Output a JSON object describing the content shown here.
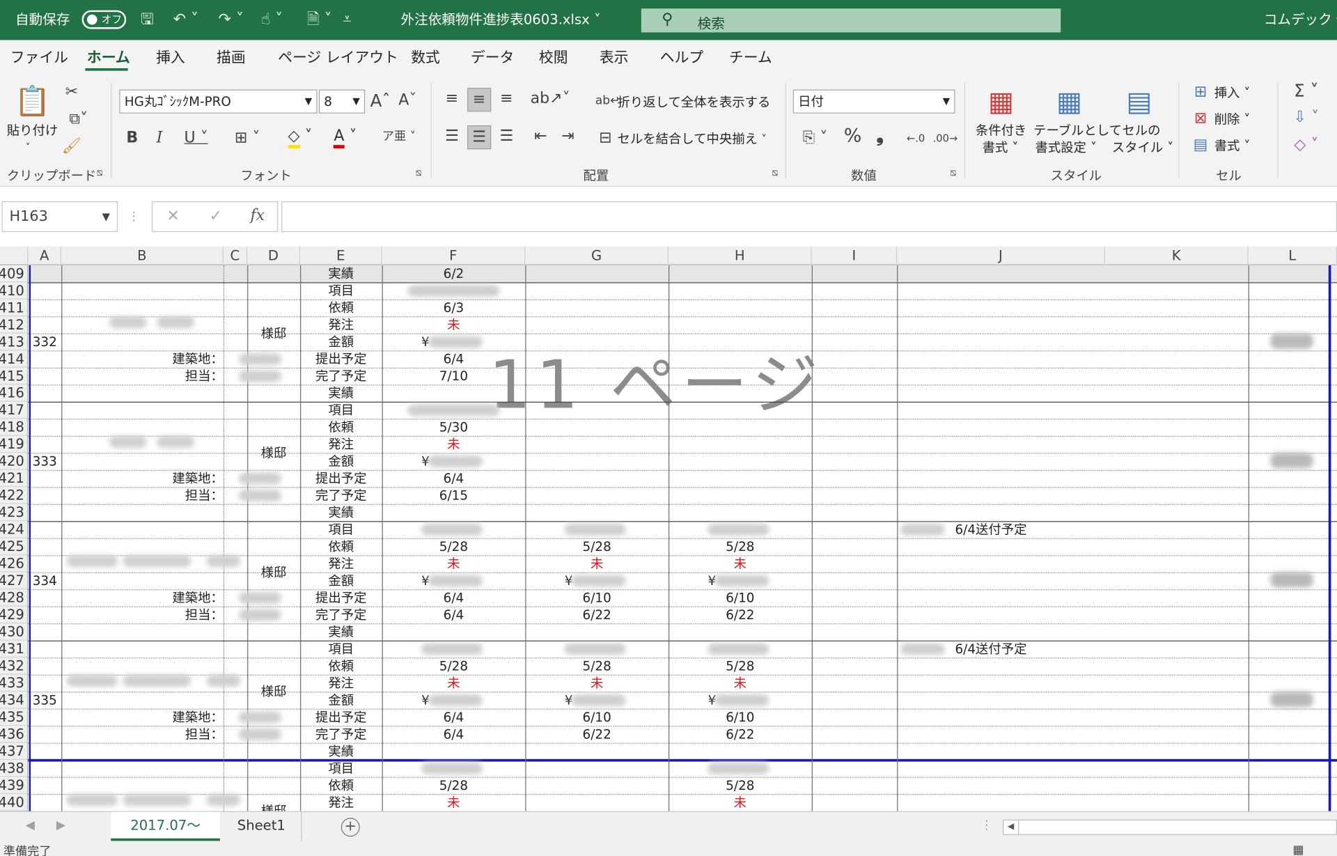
{
  "titlebar": {
    "autosave": "自動保存",
    "autosave_state": "オフ",
    "filename": "外注依頼物件進捗表0603.xlsx",
    "search_placeholder": "検索",
    "user": "コムデック 佐"
  },
  "menu": [
    "ファイル",
    "ホーム",
    "挿入",
    "描画",
    "ページ レイアウト",
    "数式",
    "データ",
    "校閲",
    "表示",
    "ヘルプ",
    "チーム"
  ],
  "ribbon": {
    "paste": "貼り付け",
    "font_name": "HG丸ｺﾞｼｯｸM-PRO",
    "font_size": "8",
    "wrap_text": "折り返して全体を表示する",
    "merge_center": "セルを結合して中央揃え",
    "number_format": "日付",
    "cond_format": [
      "条件付き",
      "書式"
    ],
    "table_format": [
      "テーブルとして",
      "書式設定"
    ],
    "cell_style": [
      "セルの",
      "スタイル"
    ],
    "insert": "挿入",
    "delete": "削除",
    "format": "書式",
    "groups": [
      "クリップボード",
      "フォント",
      "配置",
      "数値",
      "スタイル",
      "セル"
    ]
  },
  "formula_bar": {
    "name_box": "H163",
    "fx": "fx",
    "value": ""
  },
  "columns": [
    "A",
    "B",
    "C",
    "D",
    "E",
    "F",
    "G",
    "H",
    "I",
    "J",
    "K",
    "L"
  ],
  "rows": [
    "409",
    "410",
    "411",
    "412",
    "413",
    "414",
    "415",
    "416",
    "417",
    "418",
    "419",
    "420",
    "421",
    "422",
    "423",
    "424",
    "425",
    "426",
    "427",
    "428",
    "429",
    "430",
    "431",
    "432",
    "433",
    "434",
    "435",
    "436",
    "437",
    "438",
    "439",
    "440"
  ],
  "watermark": "11 ページ",
  "labels": {
    "field_labels": [
      "実績",
      "項目",
      "依頼",
      "発注",
      "金額",
      "提出予定",
      "完了予定",
      "実績"
    ],
    "sama": "様邸",
    "site": "建築地：",
    "staff": "担当：",
    "mi": "未",
    "yen": "¥"
  },
  "top_row": {
    "label": "実績",
    "f": "6/2"
  },
  "records": [
    {
      "no": "332",
      "f": {
        "irai": "6/3",
        "hatchu": "未",
        "teishutsu": "6/4",
        "kanryo": "7/10"
      }
    },
    {
      "no": "333",
      "f": {
        "irai": "5/30",
        "hatchu": "未",
        "teishutsu": "6/4",
        "kanryo": "6/15"
      }
    },
    {
      "no": "334",
      "f": {
        "irai": "5/28",
        "hatchu": "未",
        "teishutsu": "6/4",
        "kanryo": "6/4"
      },
      "g": {
        "irai": "5/28",
        "hatchu": "未",
        "teishutsu": "6/10",
        "kanryo": "6/22"
      },
      "h": {
        "irai": "5/28",
        "hatchu": "未",
        "teishutsu": "6/10",
        "kanryo": "6/22"
      },
      "j": "6/4送付予定"
    },
    {
      "no": "335",
      "f": {
        "irai": "5/28",
        "hatchu": "未",
        "teishutsu": "6/4",
        "kanryo": "6/4"
      },
      "g": {
        "irai": "5/28",
        "hatchu": "未",
        "teishutsu": "6/10",
        "kanryo": "6/22"
      },
      "h": {
        "irai": "5/28",
        "hatchu": "未",
        "teishutsu": "6/10",
        "kanryo": "6/22"
      },
      "j": "6/4送付予定"
    },
    {
      "f": {
        "irai": "5/28",
        "hatchu": "未"
      },
      "h": {
        "irai": "5/28",
        "hatchu": "未"
      }
    }
  ],
  "sheets": [
    "2017.07～",
    "Sheet1"
  ],
  "status": "準備完了"
}
